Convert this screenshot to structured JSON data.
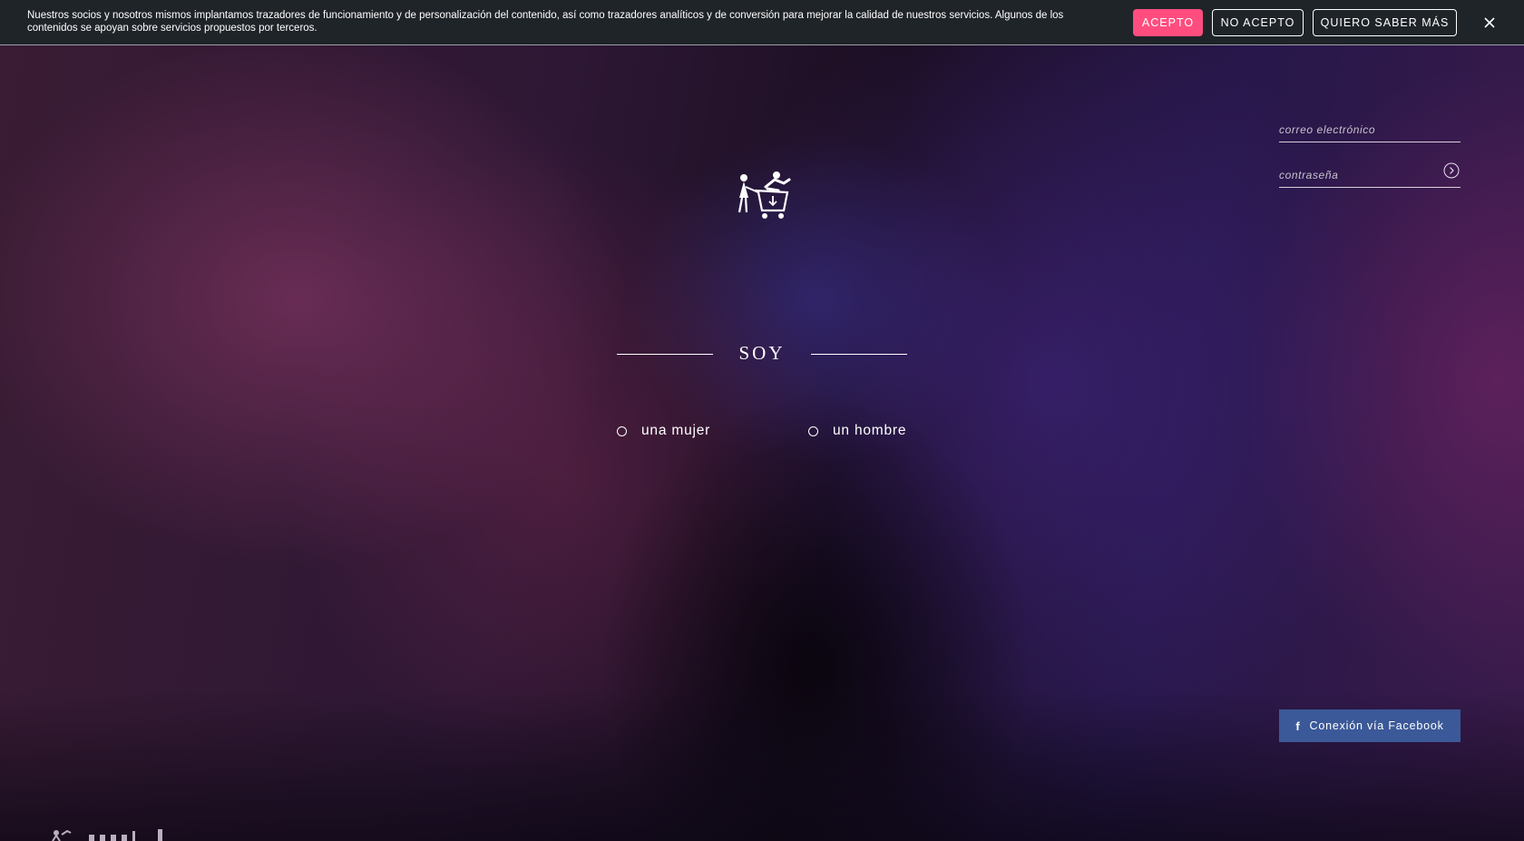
{
  "cookie_banner": {
    "text": "Nuestros socios y nosotros mismos implantamos trazadores de funcionamiento y de personalización del contenido, así como trazadores analíticos y de conversión para mejorar la calidad de nuestros servicios. Algunos de los contenidos se apoyan sobre servicios propuestos por terceros.",
    "accept_label": "ACEPTO",
    "reject_label": "NO ACEPTO",
    "more_label": "QUIERO SABER MÁS",
    "close_icon": "close-icon"
  },
  "logo": {
    "icon": "shopping-cart-couple-logo"
  },
  "gender": {
    "title": "SOY",
    "options": [
      {
        "label": "una mujer"
      },
      {
        "label": "un hombre"
      }
    ]
  },
  "login": {
    "email_placeholder": "correo electrónico",
    "password_placeholder": "contraseña",
    "submit_icon": "arrow-right-circle-icon"
  },
  "facebook": {
    "icon": "facebook-icon",
    "label": "Conexión vía Facebook"
  },
  "colors": {
    "accent": "#ff4d7f",
    "facebook": "#3b5998",
    "banner_bg": "#1f2429"
  }
}
